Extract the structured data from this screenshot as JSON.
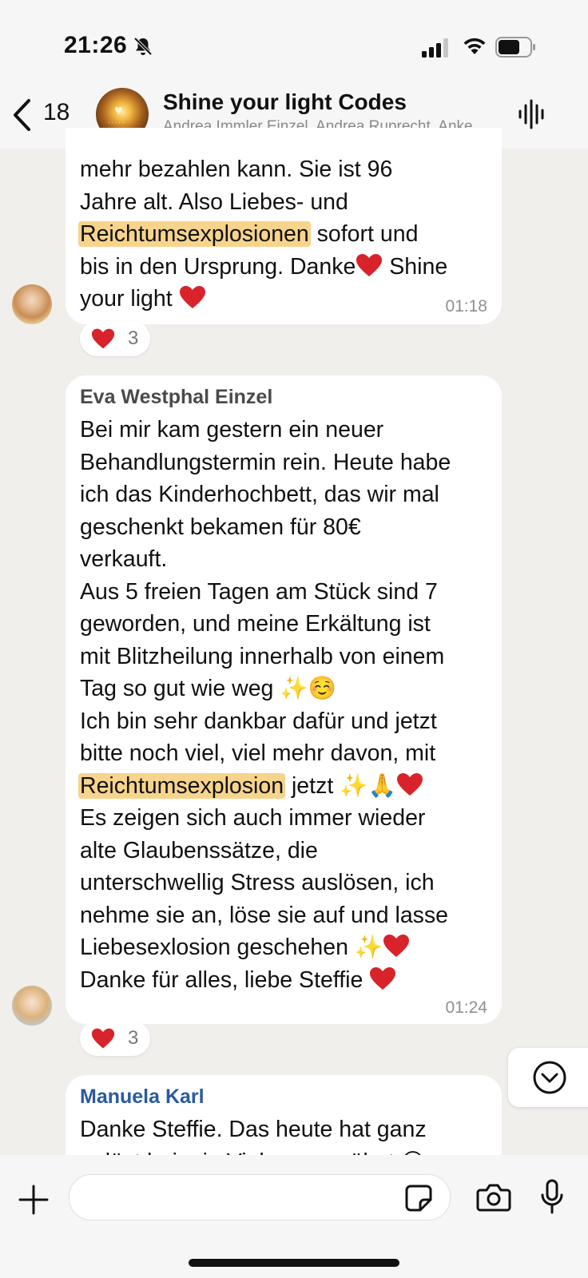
{
  "status_bar": {
    "time": "21:26"
  },
  "header": {
    "back_count": "18",
    "title": "Shine your light Codes",
    "subtitle": "Andrea Immler Einzel, Andrea Ruprecht, Anke, Anna, Bettina"
  },
  "messages": [
    {
      "text_pre": "mehr bezahlen kann. Sie ist 96\nJahre alt. Also Liebes- und\n",
      "highlight": "Reichtumsexplosionen",
      "text_post": " sofort und\nbis in den Ursprung. Danke",
      "text_post2": " Shine\nyour light ",
      "time": "01:18",
      "reaction": {
        "emoji": "heart",
        "count": "3"
      }
    },
    {
      "sender": "Eva Westphal Einzel",
      "text_a": "Bei mir kam gestern ein neuer\nBehandlungstermin rein. Heute habe\nich das Kinderhochbett, das wir mal\ngeschenkt bekamen für 80€\nverkauft.\nAus 5 freien Tagen am Stück sind 7\ngeworden, und meine Erkältung ist\nmit Blitzheilung innerhalb von einem\nTag so gut wie weg ✨☺️\nIch bin sehr dankbar dafür und jetzt\nbitte noch viel, viel mehr davon, mit\n",
      "highlight": "Reichtumsexplosion",
      "text_b": " jetzt ✨🙏",
      "text_c": "\nEs zeigen sich auch immer wieder\nalte Glaubenssätze, die\nunterschwellig Stress auslösen, ich\nnehme sie an, löse sie auf und lasse\nLiebesexlosion geschehen ✨",
      "text_d": "\nDanke für alles, liebe Steffie ",
      "time": "01:24",
      "reaction": {
        "emoji": "heart",
        "count": "3"
      }
    },
    {
      "sender": "Manuela Karl",
      "text": "Danke Steffie. Das heute hat ganz\ngelöst bei mir. Viel weggegähnt 😅"
    }
  ],
  "colors": {
    "background": "#f1efeb",
    "bubble": "#ffffff",
    "highlight": "#f6d48c",
    "sender_eva": "#4a4a4a",
    "sender_manuela": "#2a5aa0"
  }
}
